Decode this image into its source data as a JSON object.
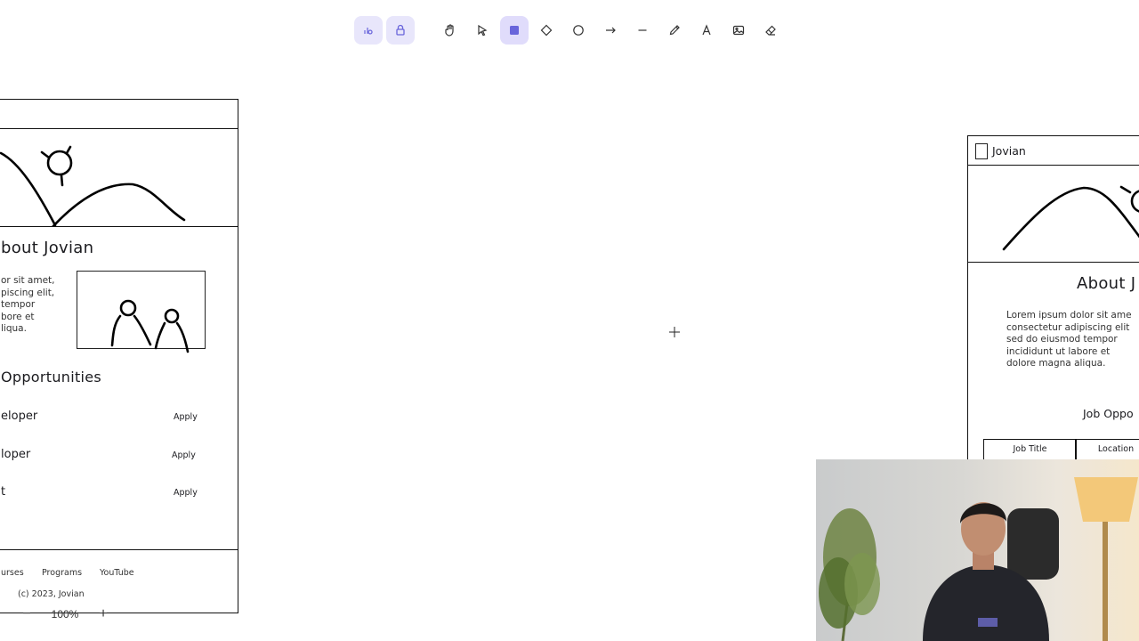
{
  "toolbar": {
    "tools": [
      {
        "name": "shapes-lock-icon"
      },
      {
        "name": "lock-icon"
      },
      {
        "name": "hand-icon"
      },
      {
        "name": "selection-pointer-icon"
      },
      {
        "name": "rectangle-icon",
        "active": true
      },
      {
        "name": "diamond-icon"
      },
      {
        "name": "ellipse-icon"
      },
      {
        "name": "arrow-icon"
      },
      {
        "name": "line-icon"
      },
      {
        "name": "pencil-icon"
      },
      {
        "name": "text-icon"
      },
      {
        "name": "image-icon"
      },
      {
        "name": "eraser-icon"
      }
    ],
    "accent": "#6965db"
  },
  "left_frame": {
    "about_heading": "bout Jovian",
    "about_text": "or sit amet,\npiscing elit,\ntempor\nbore et\nliqua.",
    "opportunities_heading": "Opportunities",
    "jobs": [
      {
        "title": "eloper",
        "action": "Apply"
      },
      {
        "title": "loper",
        "action": "Apply"
      },
      {
        "title": "t",
        "action": "Apply"
      }
    ],
    "footer_links": [
      "urses",
      "Programs",
      "YouTube"
    ],
    "copyright": "(c) 2023, Jovian"
  },
  "right_frame": {
    "brand": "Jovian",
    "about_heading": "About J",
    "about_text": "Lorem ipsum dolor sit ame\nconsectetur adipiscing elit\nsed do eiusmod tempor\nincididunt ut labore et\ndolore magna aliqua.",
    "opportunities_heading": "Job Oppo",
    "table_headers": [
      "Job Title",
      "Location"
    ]
  },
  "zoom": {
    "minus": "−",
    "value": "100%",
    "plus": "+"
  }
}
